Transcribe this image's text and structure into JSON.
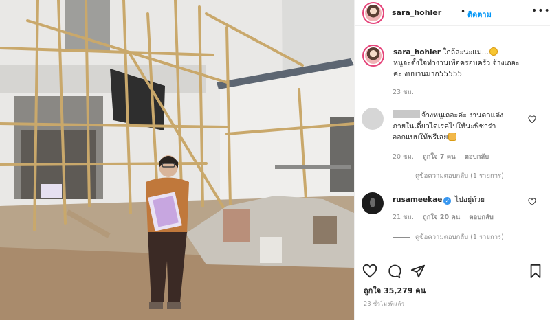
{
  "header": {
    "username": "sara_hohler",
    "separator": "•",
    "follow_label": "ติดตาม",
    "more_label": "•••"
  },
  "caption": {
    "username": "sara_hohler",
    "text_line1": "ใกล้ละนะแม่...",
    "text_line2": "หนูจะตั้งใจทำงานเพื่อครอบครัว จ้างเถอะ",
    "text_line3": "ค่ะ งบบานมาก55555",
    "time": "23 ชม."
  },
  "comments": [
    {
      "username_hidden": true,
      "text_line1": "จ้างหนูเถอะค่ะ งานตกแต่ง",
      "text_line2": "ภายในเดี๋ยวไดเรคไปให้นะพี่ซาร่า",
      "text_line3": "ออกแบบให้ฟรีเลย",
      "time": "20 ชม.",
      "likes": "ถูกใจ 7 คน",
      "reply_label": "ตอบกลับ",
      "view_replies": "ดูข้อความตอบกลับ (1 รายการ)"
    },
    {
      "username": "rusameekae",
      "verified_mark": "✓",
      "text": "ไปอยู่ด้วย",
      "time": "21 ชม.",
      "likes": "ถูกใจ 20 คน",
      "reply_label": "ตอบกลับ",
      "view_replies": "ดูข้อความตอบกลับ (1 รายการ)"
    }
  ],
  "footer": {
    "likes": "ถูกใจ 35,279 คน",
    "posted": "23 ชั่วโมงที่แล้ว"
  },
  "icons": {
    "like": "heart-icon",
    "comment": "comment-icon",
    "share": "paper-plane-icon",
    "save": "bookmark-icon"
  },
  "colors": {
    "follow": "#0095f6",
    "verified": "#3897f0",
    "meta_text": "#8e8e8e",
    "story_ring": "#e5447a"
  }
}
